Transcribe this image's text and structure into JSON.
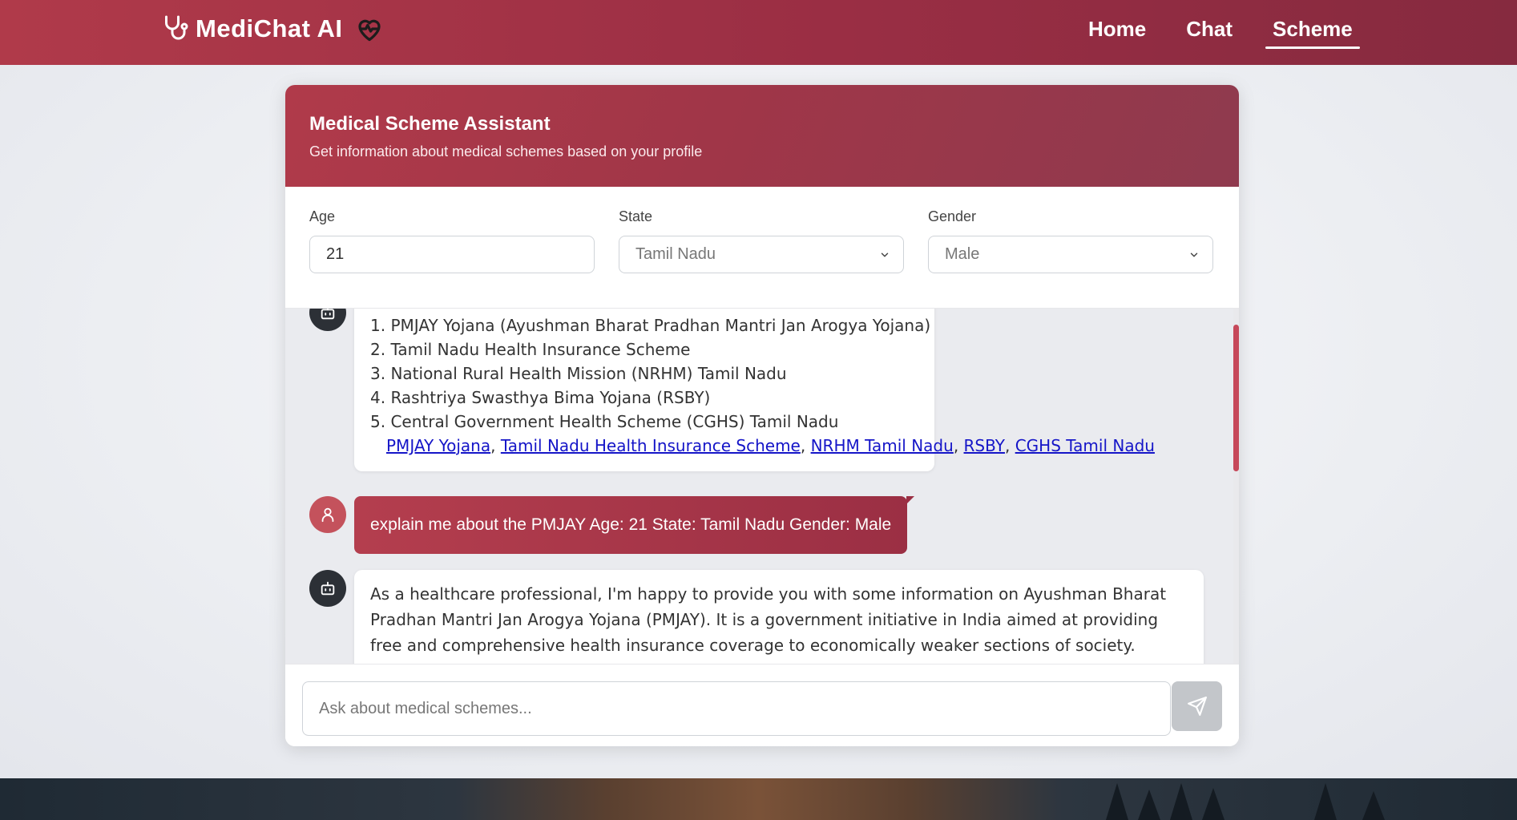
{
  "navbar": {
    "brand_title": "MediChat AI",
    "links": [
      {
        "label": "Home",
        "active": false
      },
      {
        "label": "Chat",
        "active": false
      },
      {
        "label": "Scheme",
        "active": true
      }
    ]
  },
  "card": {
    "title": "Medical Scheme Assistant",
    "subtitle": "Get information about medical schemes based on your profile"
  },
  "profile": {
    "age": {
      "label": "Age",
      "value": "21"
    },
    "state": {
      "label": "State",
      "value": "Tamil Nadu"
    },
    "gender": {
      "label": "Gender",
      "value": "Male"
    }
  },
  "messages": [
    {
      "sender": "bot",
      "items": [
        "PMJAY Yojana (Ayushman Bharat Pradhan Mantri Jan Arogya Yojana)",
        "Tamil Nadu Health Insurance Scheme",
        "National Rural Health Mission (NRHM) Tamil Nadu",
        "Rashtriya Swasthya Bima Yojana (RSBY)",
        "Central Government Health Scheme (CGHS) Tamil Nadu"
      ],
      "item_numbers": [
        "1.",
        "2.",
        "3.",
        "4.",
        "5."
      ],
      "links": [
        "PMJAY Yojana",
        "Tamil Nadu Health Insurance Scheme",
        "NRHM Tamil Nadu",
        "RSBY",
        "CGHS Tamil Nadu"
      ],
      "separator": ", "
    },
    {
      "sender": "user",
      "text": "explain me about the PMJAY Age: 21 State: Tamil Nadu Gender: Male"
    },
    {
      "sender": "bot",
      "text": "As a healthcare professional, I'm happy to provide you with some information on Ayushman Bharat Pradhan Mantri Jan Arogya Yojana (PMJAY). It is a government initiative in India aimed at providing free and comprehensive health insurance coverage to economically weaker sections of society."
    }
  ],
  "input": {
    "placeholder": "Ask about medical schemes..."
  },
  "colors": {
    "brand": "#b03a4a",
    "brand_dark": "#862a3f",
    "link": "#1515c8",
    "scrollbar": "#c6485a"
  },
  "icons": {
    "brand": "stethoscope-icon",
    "brand_badge": "heart-pulse-icon",
    "bot": "robot-icon",
    "user": "user-icon",
    "send": "send-icon",
    "select": "chevron-down-icon"
  }
}
